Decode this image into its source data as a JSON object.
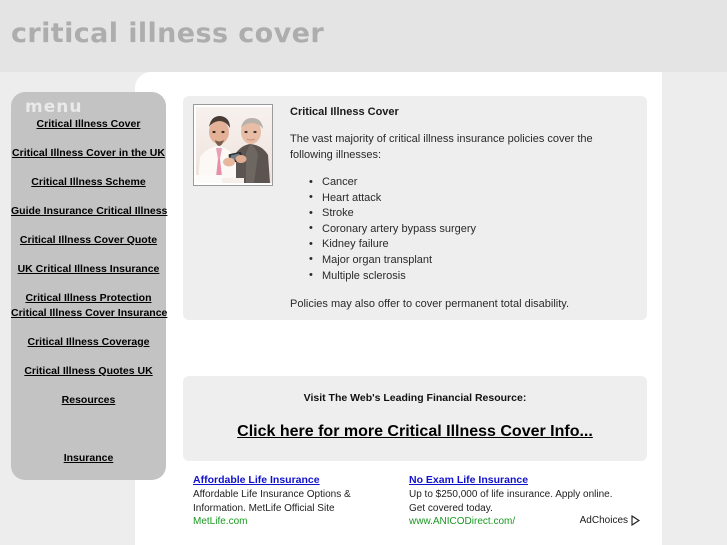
{
  "header": {
    "site_title": "critical illness cover",
    "band_color": "#e4e4e4",
    "title_color": "#adadad"
  },
  "sidebar": {
    "label": "menu",
    "background_color": "#c3c3c3",
    "label_color": "#e9e9e9",
    "items": [
      {
        "label": "Critical Illness Cover",
        "spacing": "first"
      },
      {
        "label": "Critical Illness Cover in the UK",
        "spacing": "gap-std"
      },
      {
        "label": "Critical Illness Scheme",
        "spacing": "gap-std"
      },
      {
        "label": "Guide Insurance Critical Illness",
        "spacing": "gap-std"
      },
      {
        "label": "Critical Illness Cover Quote",
        "spacing": "gap-std"
      },
      {
        "label": "UK Critical Illness Insurance",
        "spacing": "gap-std"
      },
      {
        "label": "Critical Illness Protection",
        "spacing": "gap-std"
      },
      {
        "label": "Critical Illness Cover Insurance",
        "spacing": "gap-tight"
      },
      {
        "label": "Critical Illness Coverage",
        "spacing": "gap-std"
      },
      {
        "label": "Critical Illness Quotes UK",
        "spacing": "gap-std"
      },
      {
        "label": "Resources",
        "spacing": "gap-std"
      },
      {
        "label": "Insurance",
        "spacing": "gap-big"
      }
    ]
  },
  "article": {
    "image_name": "two-men-looking-at-phone-photo",
    "title": "Critical Illness Cover",
    "intro": "The vast majority of critical illness insurance policies cover the following illnesses:",
    "illnesses": [
      "Cancer",
      "Heart attack",
      "Stroke",
      "Coronary artery bypass surgery",
      "Kidney failure",
      "Major organ transplant",
      "Multiple sclerosis"
    ],
    "footer": "Policies may also offer to cover permanent total disability."
  },
  "promo": {
    "kicker": "Visit The Web's Leading Financial Resource:",
    "link_text": "Click here for more Critical Illness Cover Info..."
  },
  "ads": {
    "adchoices_label": "AdChoices",
    "title_color": "#1111cc",
    "url_color": "#1a9822",
    "units": [
      {
        "title": "Affordable Life Insurance",
        "line1": "Affordable Life Insurance Options &",
        "line2": "Information. MetLife Official Site",
        "url": "MetLife.com"
      },
      {
        "title": "No Exam Life Insurance",
        "line1": "Up to $250,000 of life insurance. Apply online.",
        "line2": "Get covered today.",
        "url": "www.ANICODirect.com/"
      }
    ]
  }
}
